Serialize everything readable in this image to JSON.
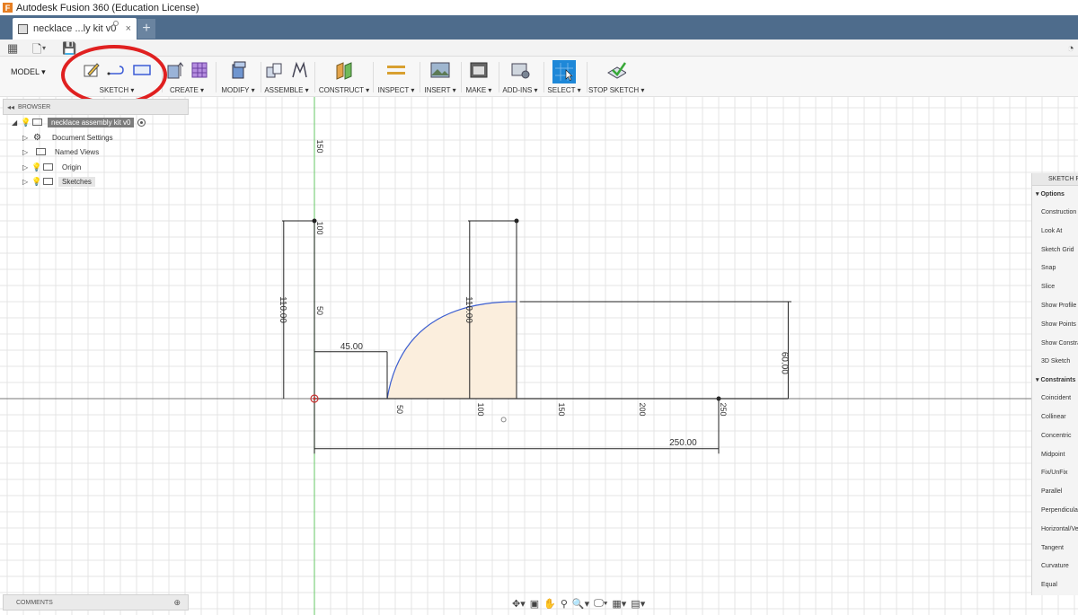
{
  "window": {
    "title": "Autodesk Fusion 360 (Education License)"
  },
  "tab": {
    "label": "necklace ...ly kit v0",
    "new_tab": "+"
  },
  "toolbar": {
    "workspace": "MODEL ▾",
    "groups": [
      {
        "label": "SKETCH ▾"
      },
      {
        "label": "CREATE ▾"
      },
      {
        "label": "MODIFY ▾"
      },
      {
        "label": "ASSEMBLE ▾"
      },
      {
        "label": "CONSTRUCT ▾"
      },
      {
        "label": "INSPECT ▾"
      },
      {
        "label": "INSERT ▾"
      },
      {
        "label": "MAKE ▾"
      },
      {
        "label": "ADD-INS ▾"
      },
      {
        "label": "SELECT ▾"
      },
      {
        "label": "STOP SKETCH ▾"
      }
    ]
  },
  "browser": {
    "title": "BROWSER",
    "root": "necklace assembly kit v0",
    "items": [
      "Document Settings",
      "Named Views",
      "Origin",
      "Sketches"
    ]
  },
  "sketch": {
    "axis_labels_vertical": [
      "150",
      "100",
      "50"
    ],
    "axis_labels_horizontal": [
      "50",
      "100",
      "150",
      "200",
      "250"
    ],
    "dimensions": [
      "110.00",
      "110.00",
      "45.00",
      "60.00",
      "250.00"
    ]
  },
  "palette": {
    "title": "SKETCH PALETTE",
    "options_header": "Options",
    "options": [
      "Construction",
      "Look At",
      "Sketch Grid",
      "Snap",
      "Slice",
      "Show Profile",
      "Show Points",
      "Show Constraints",
      "3D Sketch"
    ],
    "constraints_header": "Constraints",
    "constraints": [
      "Coincident",
      "Collinear",
      "Concentric",
      "Midpoint",
      "Fix/UnFix",
      "Parallel",
      "Perpendicular",
      "Horizontal/Vertical",
      "Tangent",
      "Curvature",
      "Equal"
    ]
  },
  "comments": {
    "title": "COMMENTS"
  },
  "colors": {
    "tabbar": "#4e6c8c",
    "annotation": "#e02020",
    "profile_fill": "#fbeedd",
    "arc": "#3d5fd0",
    "grid": "#e4e4e4",
    "y_axis": "#7fd07f"
  }
}
